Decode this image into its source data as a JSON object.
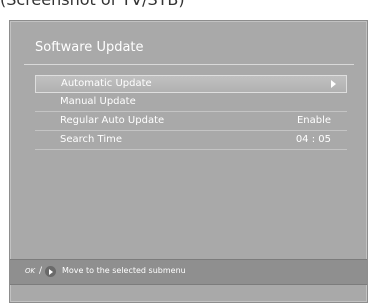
{
  "caption": "(Screenshot of TV/STB)",
  "title": "Software Update",
  "menu": [
    {
      "label": "Automatic Update",
      "value": "",
      "selected": true
    },
    {
      "label": "Manual Update",
      "value": ""
    },
    {
      "label": "Regular Auto Update",
      "value": "Enable"
    },
    {
      "label": "Search Time",
      "value": "04 : 05"
    }
  ],
  "footer": {
    "ok_label": "OK",
    "separator": "/",
    "hint": "Move to the selected submenu"
  },
  "icons": {
    "submenu_arrow": "chevron-right",
    "right_key": "right-arrow-button"
  }
}
